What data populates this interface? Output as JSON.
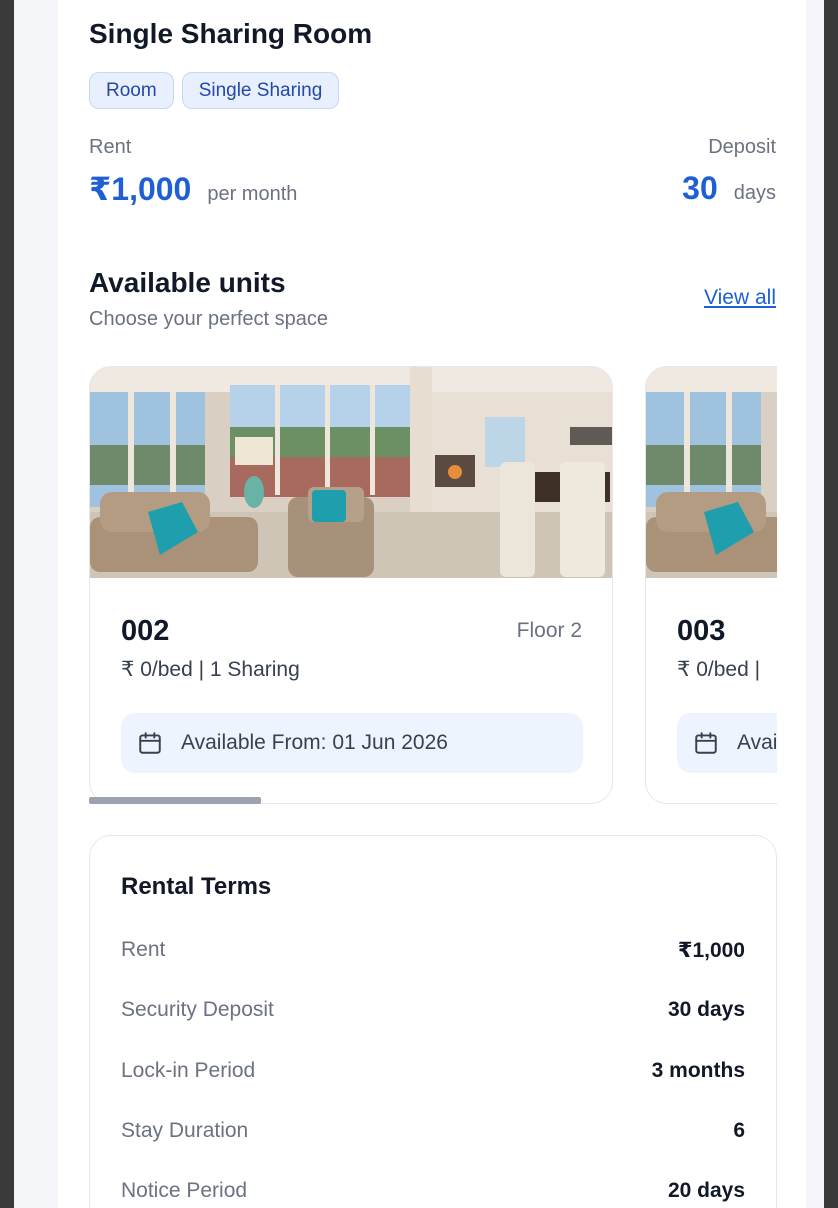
{
  "room": {
    "title": "Single Sharing Room",
    "tags": [
      "Room",
      "Single Sharing"
    ],
    "rent_label": "Rent",
    "rent_amount": "₹1,000",
    "rent_unit": "per month",
    "deposit_label": "Deposit",
    "deposit_amount": "30",
    "deposit_unit": "days"
  },
  "units_section": {
    "title": "Available units",
    "subtitle": "Choose your perfect space",
    "view_all": "View all",
    "units": [
      {
        "number": "002",
        "floor": "Floor 2",
        "price": "₹ 0/bed | 1 Sharing",
        "available": "Available From: 01 Jun 2026"
      },
      {
        "number": "003",
        "floor": "",
        "price": "₹ 0/bed |",
        "available": "Avai"
      }
    ]
  },
  "rental_terms": {
    "title": "Rental Terms",
    "rows": [
      {
        "label": "Rent",
        "value": "₹1,000"
      },
      {
        "label": "Security Deposit",
        "value": "30 days"
      },
      {
        "label": "Lock-in Period",
        "value": "3 months"
      },
      {
        "label": "Stay Duration",
        "value": "6"
      },
      {
        "label": "Notice Period",
        "value": "20 days"
      }
    ]
  },
  "colors": {
    "accent": "#1f5fd6",
    "chip_bg": "#e8f0fd",
    "avail_bg": "#edf4fd"
  },
  "icons": [
    "calendar-icon"
  ]
}
